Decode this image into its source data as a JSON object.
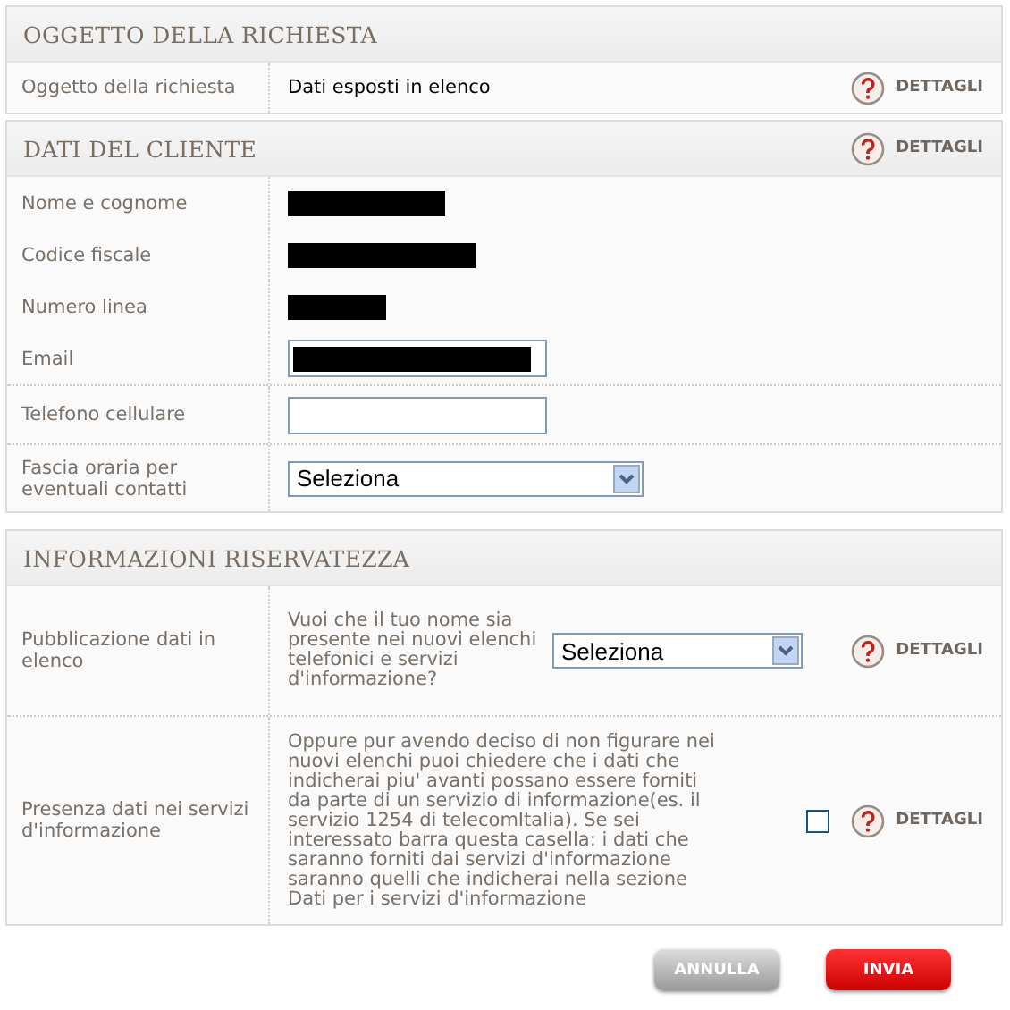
{
  "sections": [
    {
      "title": "OGGETTO DELLA RICHIESTA",
      "groups": [
        [
          {
            "label": "Oggetto della richiesta",
            "kind": "text",
            "value": "Dati esposti in elenco",
            "help": "DETTAGLI"
          }
        ]
      ]
    },
    {
      "title": "DATI DEL CLIENTE",
      "help": "DETTAGLI",
      "groups": [
        [
          {
            "label": "Nome e cognome",
            "kind": "redacted"
          },
          {
            "label": "Codice fiscale",
            "kind": "redacted"
          },
          {
            "label": "Numero linea",
            "kind": "redacted"
          },
          {
            "label": "Email",
            "kind": "input",
            "redacted": true
          }
        ],
        [
          {
            "label": "Telefono cellulare",
            "kind": "input",
            "redacted": false
          }
        ],
        [
          {
            "label": "Fascia oraria per eventuali contatti",
            "kind": "select",
            "value": "Seleziona"
          }
        ]
      ]
    },
    {
      "title": "INFORMAZIONI RISERVATEZZA",
      "groups": [
        [
          {
            "label": "Pubblicazione dati in elenco",
            "kind": "question-select",
            "text": "Vuoi che il tuo nome sia presente nei nuovi elenchi telefonici e servizi d'informazione?",
            "value": "Seleziona",
            "help": "DETTAGLI"
          }
        ],
        [
          {
            "label": "Presenza dati nei servizi d'informazione",
            "kind": "question-check",
            "text": "Oppure pur avendo deciso di non figurare nei nuovi elenchi puoi chiedere che i dati che indicherai piu' avanti possano essere forniti da parte di un servizio di informazione(es. il servizio 1254 di telecomItalia). Se sei interessato barra questa casella: i dati che saranno forniti dai servizi d'informazione saranno quelli che indicherai nella sezione Dati per i servizi d'informazione",
            "checked": false,
            "help": "DETTAGLI"
          }
        ]
      ]
    }
  ],
  "buttons": [
    {
      "label": "ANNULLA",
      "kind": "secondary"
    },
    {
      "label": "INVIA",
      "kind": "primary"
    }
  ]
}
